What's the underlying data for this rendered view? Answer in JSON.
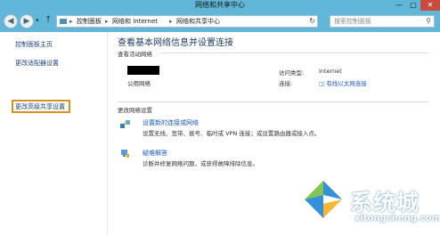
{
  "window": {
    "title": "网络和共享中心",
    "controls": {
      "minimize": "—",
      "maximize": "□",
      "close": "✕"
    }
  },
  "address_bar": {
    "nav": {
      "back": "◀",
      "forward": "▶",
      "dropdown": "▾",
      "up": "↑"
    },
    "crumbs": [
      "控制面板",
      "网络和 Internet",
      "网络和共享中心"
    ],
    "separator": "▸",
    "refresh": "↻",
    "search_placeholder": "搜索控制面板",
    "search_icon": "search-icon"
  },
  "sidebar": {
    "items": [
      {
        "label": "控制面板主页"
      },
      {
        "label": "更改适配器设置"
      },
      {
        "label": "更改高级共享设置",
        "highlighted": true
      }
    ]
  },
  "main": {
    "heading": "查看基本网络信息并设置连接",
    "active_section": {
      "label": "查看活动网络",
      "network_type": "公用网络",
      "access_type_label": "访问类型:",
      "access_type_value": "Internet",
      "connections_label": "连接:",
      "connection_value": "有线以太网连接",
      "connection_icon": "ethernet-icon"
    },
    "change_section": {
      "label": "更改网络设置",
      "tasks": [
        {
          "link": "设置新的连接或网络",
          "desc": "设置无线、宽带、拨号、临时或 VPN 连接；或设置路由器或接入点。",
          "icon": "new-connection-icon"
        },
        {
          "link": "疑难解答",
          "desc": "诊断并修复网络问题，或获得故障排除信息。",
          "icon": "troubleshoot-icon"
        }
      ]
    }
  },
  "watermark": {
    "brand": "系统城",
    "url": "xitongcheng.com",
    "logo_colors": [
      "#2b8ad6",
      "#2b8ad6",
      "#2b8ad6",
      "#2b8ad6"
    ]
  }
}
